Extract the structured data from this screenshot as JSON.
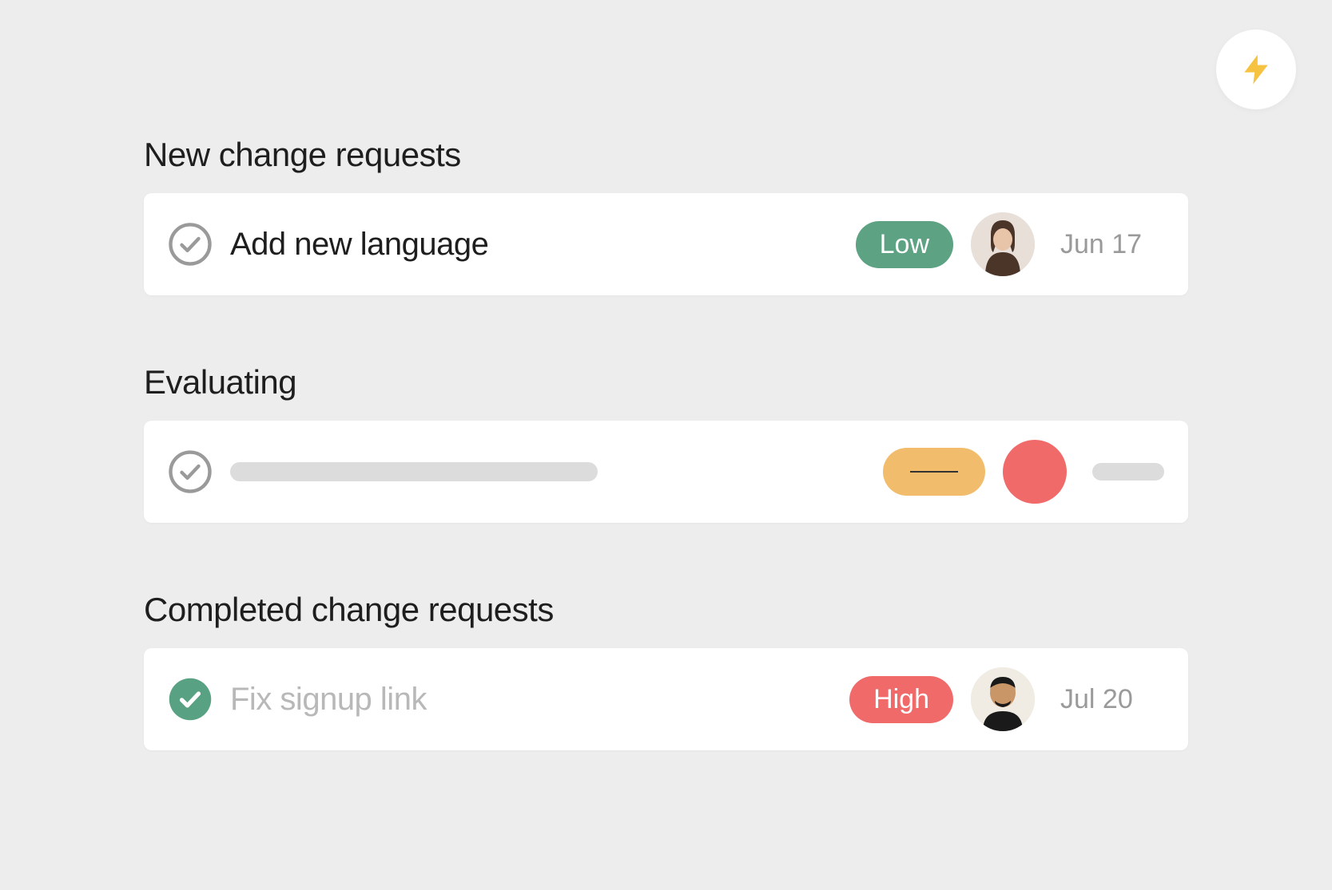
{
  "header": {
    "action_icon": "bolt-icon"
  },
  "sections": [
    {
      "title": "New change requests",
      "task": {
        "completed": false,
        "name": "Add new language",
        "priority": "Low",
        "priority_color": "#5da283",
        "assignee": "avatar-1",
        "date": "Jun 17"
      }
    },
    {
      "title": "Evaluating",
      "task": {
        "completed": false,
        "placeholder": true
      }
    },
    {
      "title": "Completed change requests",
      "task": {
        "completed": true,
        "name": "Fix signup link",
        "priority": "High",
        "priority_color": "#f06a6a",
        "assignee": "avatar-2",
        "date": "Jul 20"
      }
    }
  ]
}
